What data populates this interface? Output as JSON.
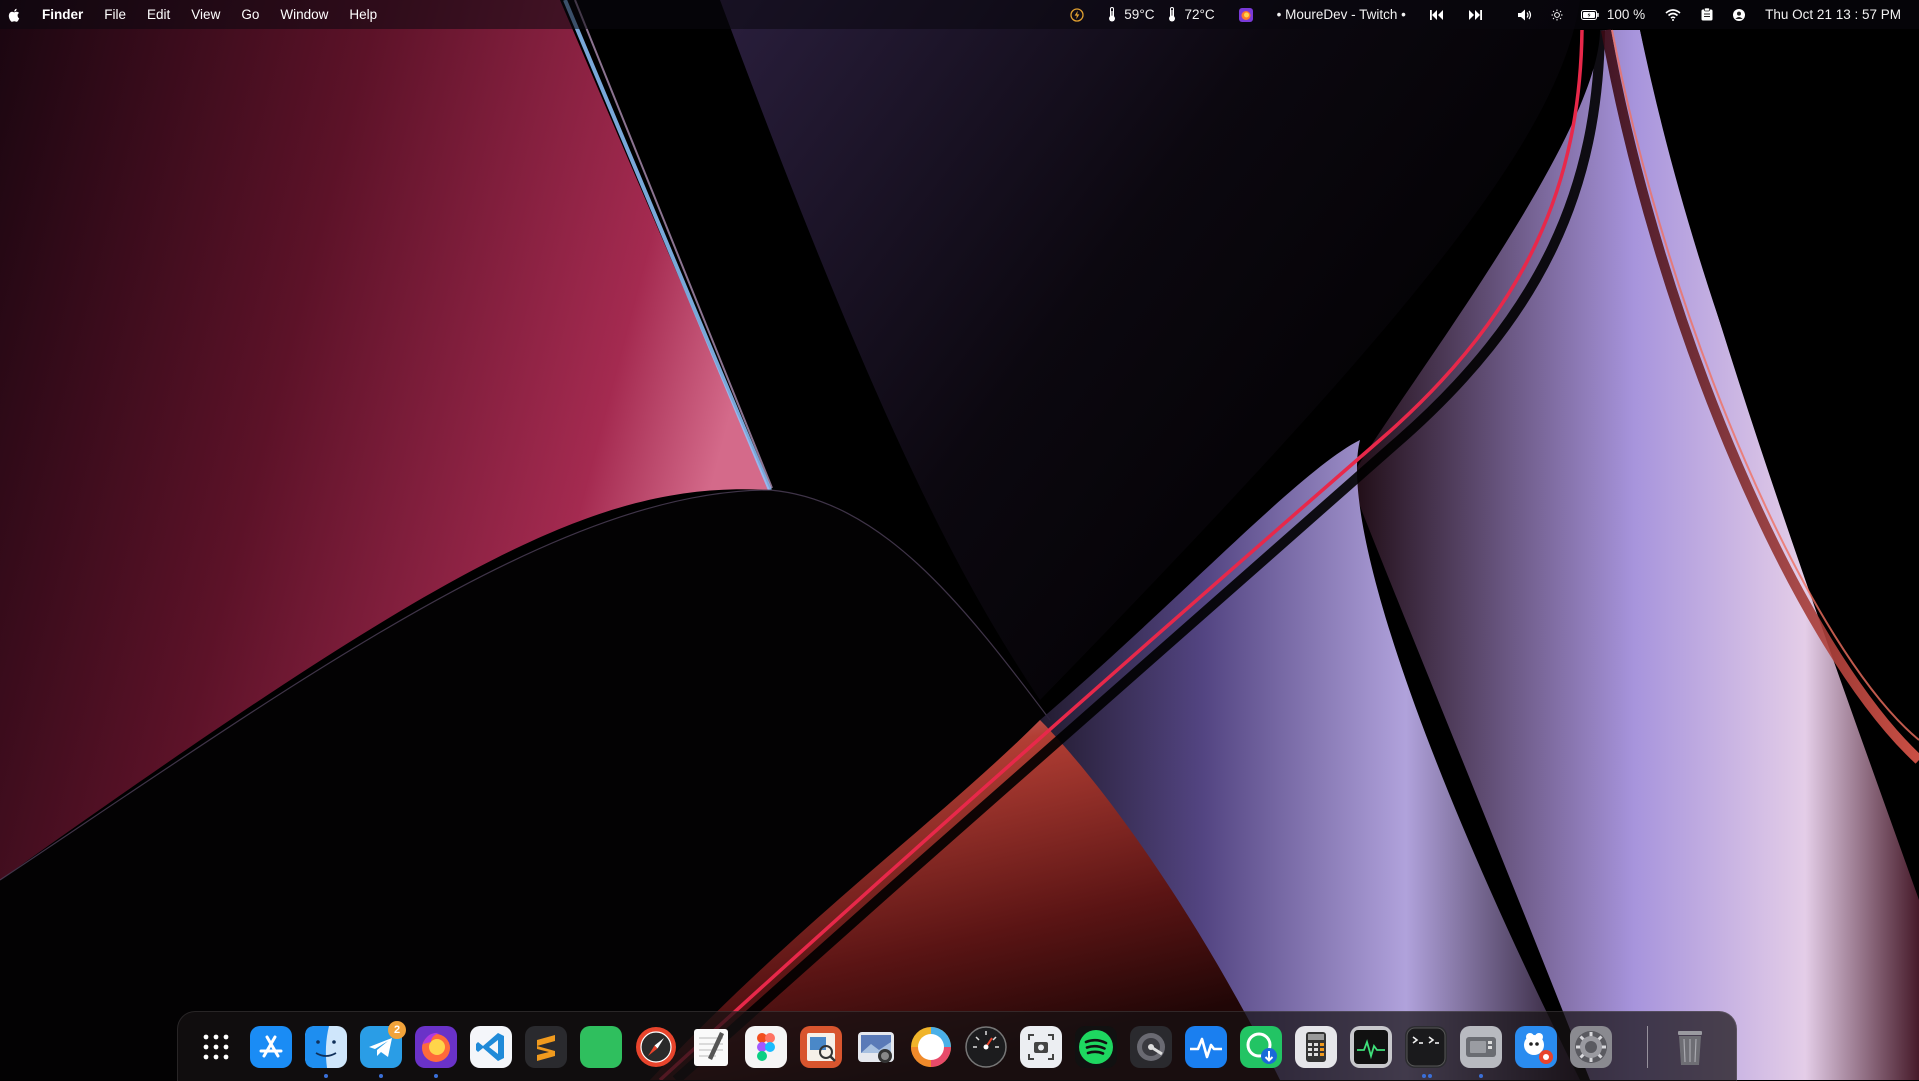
{
  "colors": {
    "menubar_bg": "#0a080e",
    "dock_bg": "#161214",
    "wallpaper_red": "#8c1c38",
    "wallpaper_violet": "#b6a4f0",
    "wallpaper_orange": "#c8542a",
    "running_dot": "#3a6fd8",
    "badge": "#f2a33a"
  },
  "menubar": {
    "apple_icon": "apple-logo-icon",
    "menus": [
      "Finder",
      "File",
      "Edit",
      "View",
      "Go",
      "Window",
      "Help"
    ],
    "status": {
      "power_icon": "bolt-icon",
      "cpu_temp": "59°C",
      "gpu_temp": "72°C",
      "now_playing": "• MoureDev - Twitch •",
      "battery": "100 %",
      "datetime": "Thu Oct 21  13 : 57  PM"
    }
  },
  "dock": {
    "apps": [
      {
        "name": "Launchpad",
        "icon": "launchpad-icon",
        "running": false
      },
      {
        "name": "App Store",
        "icon": "app-store-icon",
        "running": false
      },
      {
        "name": "Finder",
        "icon": "finder-icon",
        "running": true
      },
      {
        "name": "Telegram",
        "icon": "telegram-icon",
        "running": true,
        "badge": "2"
      },
      {
        "name": "Firefox Nightly",
        "icon": "firefox-icon",
        "running": true
      },
      {
        "name": "Visual Studio Code",
        "icon": "vscode-icon",
        "running": false
      },
      {
        "name": "Sublime Text",
        "icon": "sublime-icon",
        "running": false
      },
      {
        "name": "Green App",
        "icon": "green-app-icon",
        "running": false
      },
      {
        "name": "Compass",
        "icon": "compass-icon",
        "running": false
      },
      {
        "name": "TextEdit",
        "icon": "textedit-icon",
        "running": false
      },
      {
        "name": "Figma",
        "icon": "figma-icon",
        "running": false
      },
      {
        "name": "Preview",
        "icon": "preview-icon",
        "running": false
      },
      {
        "name": "Screenshot Path",
        "icon": "photo-capture-icon",
        "running": false
      },
      {
        "name": "Color Circle",
        "icon": "color-wheel-icon",
        "running": false
      },
      {
        "name": "Speed Gauge",
        "icon": "gauge-icon",
        "running": false
      },
      {
        "name": "Screenshot",
        "icon": "screenshot-icon",
        "running": false
      },
      {
        "name": "Spotify",
        "icon": "spotify-icon",
        "running": false
      },
      {
        "name": "Disk Utility",
        "icon": "disk-utility-icon",
        "running": false
      },
      {
        "name": "Activity Pulse",
        "icon": "pulse-icon",
        "running": false
      },
      {
        "name": "Downloader",
        "icon": "download-icon",
        "running": false
      },
      {
        "name": "Calculator",
        "icon": "calculator-icon",
        "running": false
      },
      {
        "name": "Activity Monitor",
        "icon": "activity-monitor-icon",
        "running": false
      },
      {
        "name": "Terminal",
        "icon": "terminal-icon",
        "running": true
      },
      {
        "name": "System Information",
        "icon": "system-info-icon",
        "running": true
      },
      {
        "name": "GIMP",
        "icon": "gimp-icon",
        "running": false
      },
      {
        "name": "System Preferences",
        "icon": "system-preferences-icon",
        "running": false
      }
    ],
    "trash": {
      "name": "Trash",
      "icon": "trash-icon"
    }
  }
}
